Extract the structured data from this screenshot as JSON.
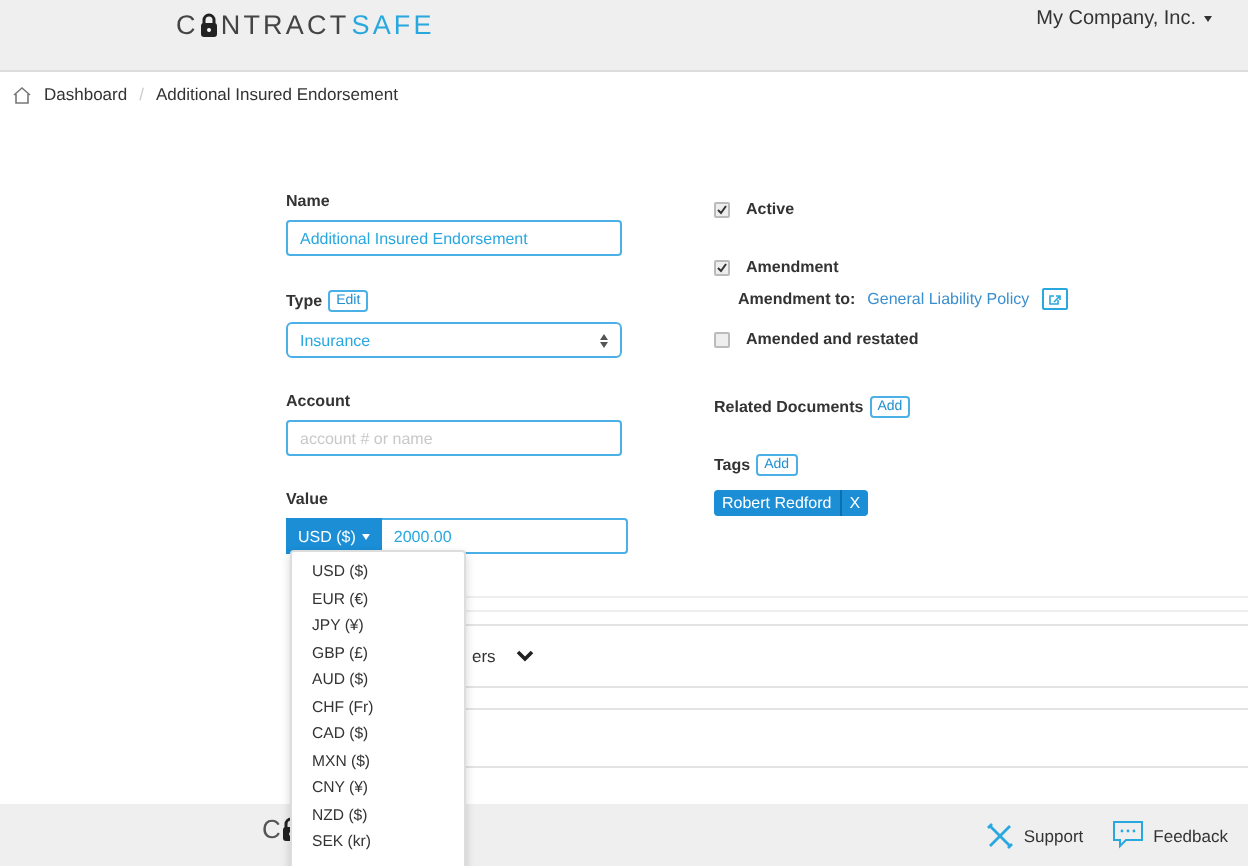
{
  "header": {
    "logo": {
      "lead": "C",
      "rest": "NTRACT",
      "accent": "SAFE"
    },
    "account_menu": "My Company, Inc."
  },
  "breadcrumb": [
    {
      "label": "Dashboard",
      "kind": "home"
    },
    {
      "separator": "/",
      "label": "Additional Insured Endorsement",
      "kind": "current"
    }
  ],
  "form": {
    "name": {
      "label": "Name",
      "value": "Additional Insured Endorsement"
    },
    "type": {
      "label": "Type",
      "edit": "Edit",
      "value": "Insurance"
    },
    "account": {
      "label": "Account",
      "placeholder": "account # or name"
    },
    "value": {
      "label": "Value",
      "currency": "USD ($)",
      "amount": "2000.00",
      "currency_menu": [
        "USD ($)",
        "EUR (€)",
        "JPY (¥)",
        "GBP (£)",
        "AUD ($)",
        "CHF (Fr)",
        "CAD ($)",
        "MXN ($)",
        "CNY (¥)",
        "NZD ($)",
        "SEK (kr)"
      ]
    }
  },
  "options": [
    {
      "label": "Active",
      "checked": true
    },
    {
      "label": "Amendment",
      "checked": true,
      "detail": {
        "label": "Amendment to:",
        "link": "General Liability Policy"
      }
    },
    {
      "label": "Amended and restated",
      "checked": false
    }
  ],
  "related_documents": {
    "label": "Related Documents",
    "add": "Add"
  },
  "tags": {
    "label": "Tags",
    "add": "Add",
    "items": [
      {
        "label": "Robert Redford",
        "remove": "X"
      }
    ]
  },
  "panels": [
    {
      "title": "ers",
      "expanded": false
    }
  ],
  "footer": {
    "logo_lead": "C",
    "links": [
      {
        "label": "Support",
        "kind": "support"
      },
      {
        "label": "Feedback",
        "kind": "feedback"
      }
    ]
  }
}
